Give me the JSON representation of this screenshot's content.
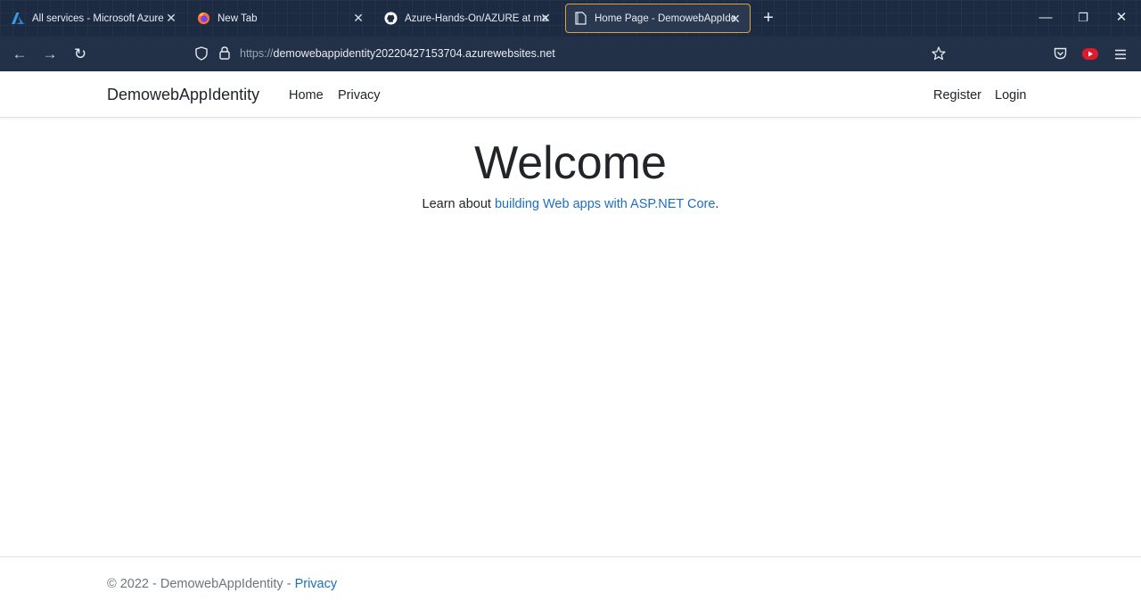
{
  "browser": {
    "tabs": [
      {
        "title": "All services - Microsoft Azure",
        "icon": "azure-icon",
        "close": "✕"
      },
      {
        "title": "New Tab",
        "icon": "firefox-icon",
        "close": "✕"
      },
      {
        "title": "Azure-Hands-On/AZURE at main",
        "icon": "github-icon",
        "close": "✕"
      },
      {
        "title": "Home Page - DemowebAppIdentity",
        "icon": "page-icon",
        "close": "✕"
      }
    ],
    "new_tab": "+",
    "window": {
      "minimize": "—",
      "restore": "❐",
      "close": "✕"
    },
    "toolbar": {
      "back": "←",
      "forward": "→",
      "reload": "↻",
      "url_scheme": "https://",
      "url_host": "demowebappidentity20220427153704.azurewebsites.net"
    }
  },
  "site": {
    "brand": "DemowebAppIdentity",
    "nav": {
      "home": "Home",
      "privacy": "Privacy",
      "register": "Register",
      "login": "Login"
    },
    "heading": "Welcome",
    "lead_prefix": "Learn about ",
    "lead_link": "building Web apps with ASP.NET Core",
    "lead_suffix": ".",
    "footer_prefix": "© 2022 - DemowebAppIdentity - ",
    "footer_link": "Privacy"
  },
  "colors": {
    "link": "#1b6ec2",
    "tab_active_border": "#d9a441",
    "chrome_bg": "#1c2b42"
  }
}
